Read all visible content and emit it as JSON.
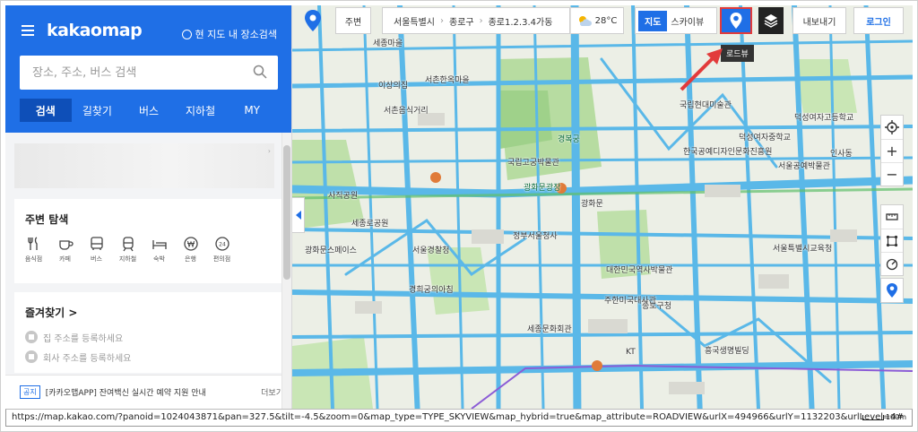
{
  "sidebar": {
    "logo": "kakaomap",
    "area_search_label": "현 지도 내 장소검색",
    "search_placeholder": "장소, 주소, 버스 검색",
    "tabs": [
      "검색",
      "길찾기",
      "버스",
      "지하철",
      "MY"
    ],
    "nearby_title": "주변 탐색",
    "categories": [
      "음식점",
      "카페",
      "버스",
      "지하철",
      "숙박",
      "은행",
      "편의점"
    ],
    "favorites_title": "즐겨찾기 >",
    "favorites": [
      "집 주소를 등록하세요",
      "회사 주소를 등록하세요"
    ],
    "notice_badge": "공지",
    "notice_text": "[카카오맵APP] 잔여백신 실시간 예약 지원 안내",
    "notice_more": "더보기"
  },
  "toolbar": {
    "nearby_label": "주변",
    "address": [
      "서울특별시",
      "종로구",
      "종로1.2.3.4가동"
    ],
    "temperature": "28°C",
    "map_type_active": "지도",
    "map_type_other": "스카이뷰",
    "roadview_tooltip": "로드뷰",
    "export_label": "내보내기",
    "login_label": "로그인"
  },
  "map_labels": [
    "세종마을",
    "서촌한옥마을",
    "이상의집",
    "서촌음식거리",
    "정부서울청사",
    "광화문",
    "광화문광장",
    "국립고궁박물관",
    "경복궁",
    "세종문화회관",
    "국립현대미술관",
    "덕성여자중학교",
    "한국공예디자인문화진흥원",
    "인사동",
    "종로구청",
    "대한민국역사박물관",
    "주한미국대사관",
    "서울경찰청",
    "사직공원",
    "경희궁의아침",
    "광화문스페이스",
    "세종로공원",
    "KT",
    "흥국생명빌딩",
    "덕성여자고등학교",
    "서울공예박물관",
    "서울특별시교육청"
  ],
  "status_url": "https://map.kakao.com/?panoid=1024043871&pan=327.5&tilt=-4.5&zoom=0&map_type=TYPE_SKYVIEW&map_hybrid=true&map_attribute=ROADVIEW&urlX=494966&urlY=1132203&urlLevel=4#",
  "scale_label": "100m",
  "colors": {
    "brand_blue": "#1f6fe6",
    "road_blue": "#5ab8e8",
    "highlight_red": "#e23b3b",
    "park_green": "#b7dca1"
  }
}
